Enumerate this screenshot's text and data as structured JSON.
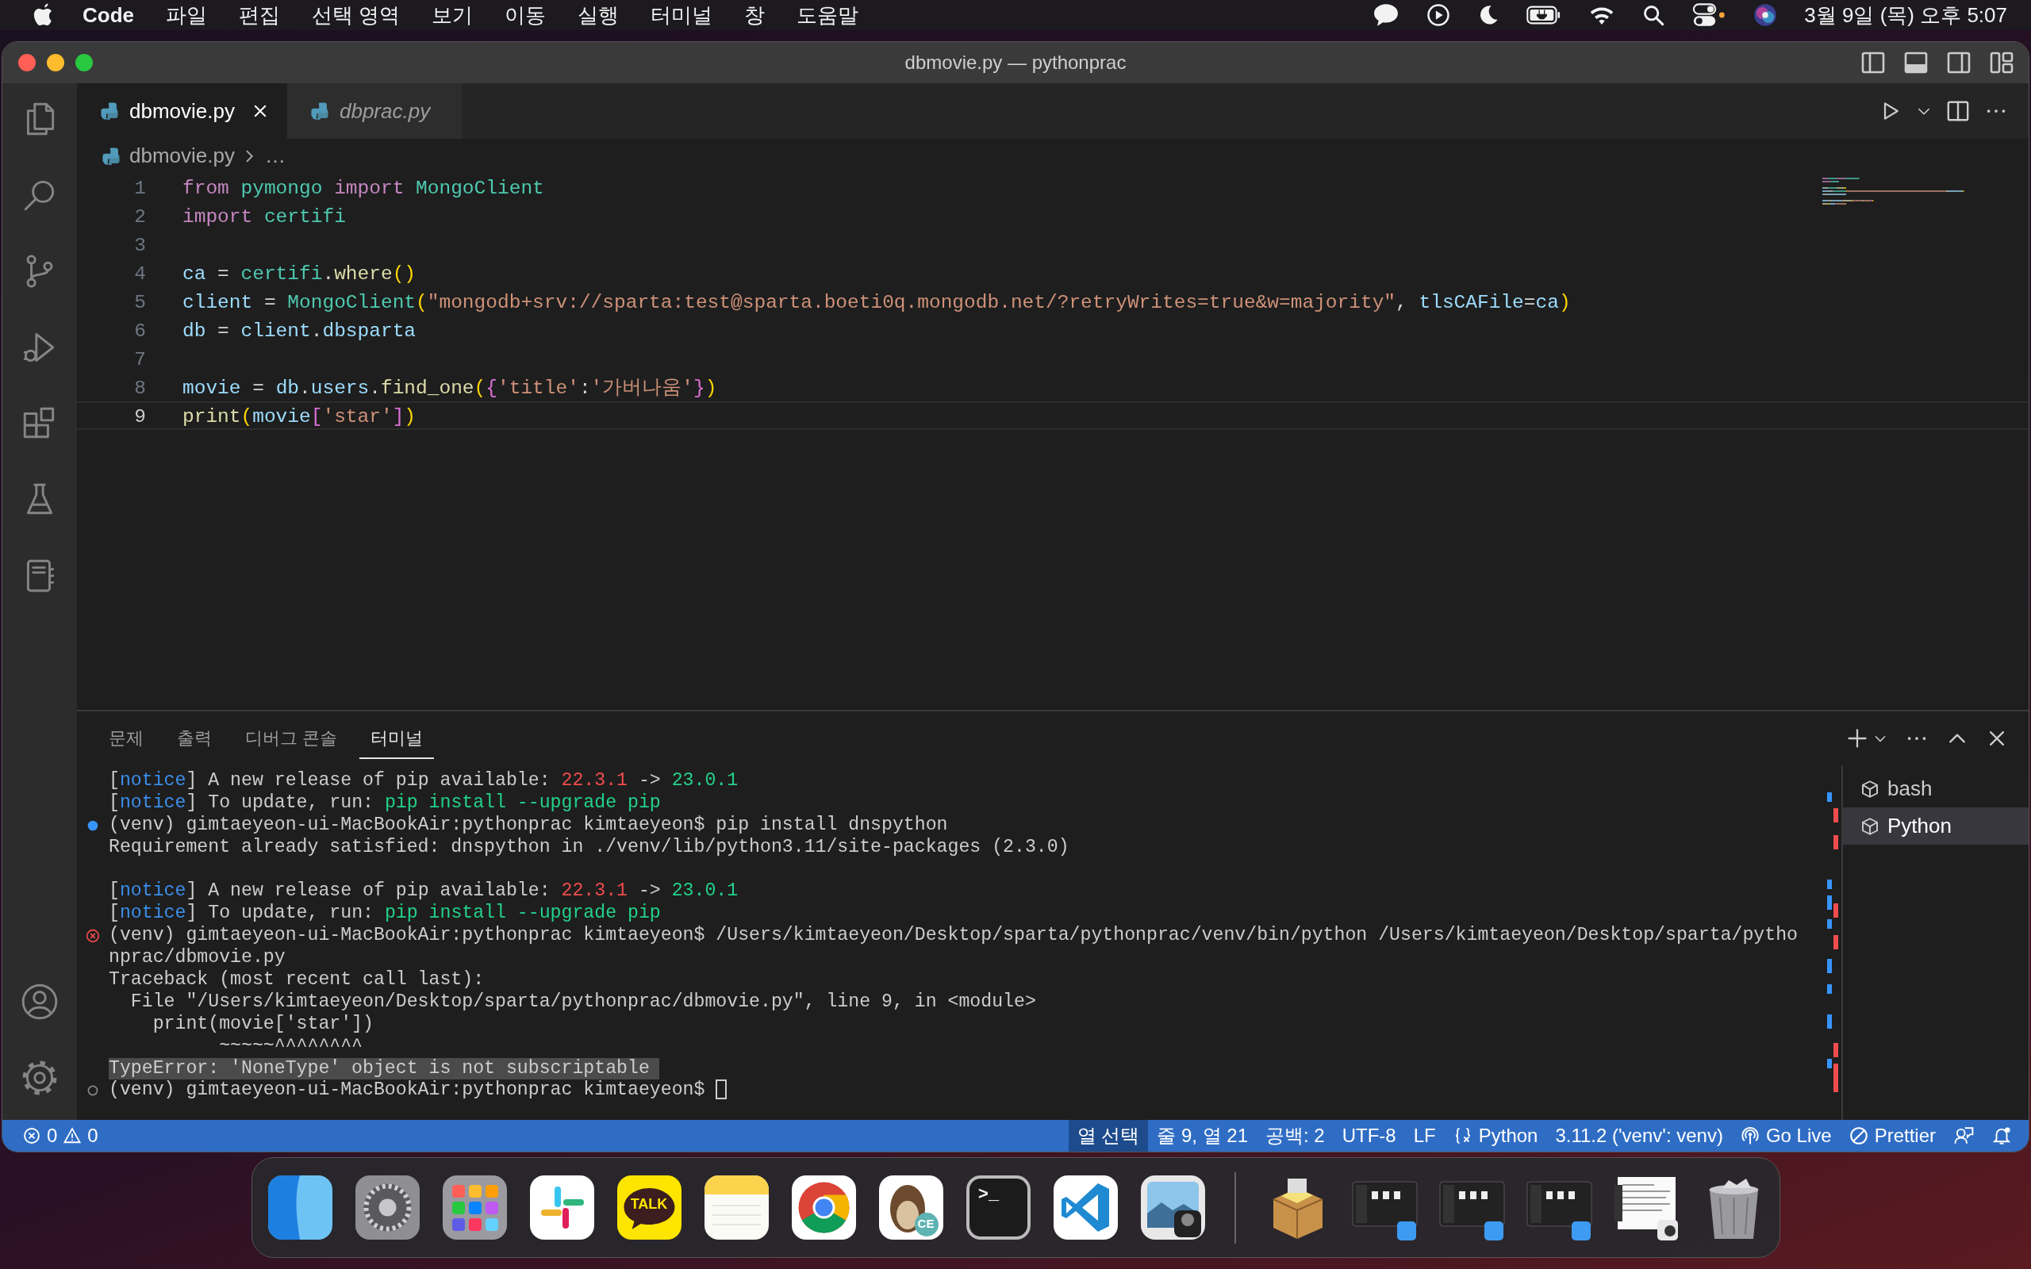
{
  "menu_bar": {
    "app": "Code",
    "menus": [
      "파일",
      "편집",
      "선택 영역",
      "보기",
      "이동",
      "실행",
      "터미널",
      "창",
      "도움말"
    ],
    "clock": "3월 9일 (목) 오후 5:07"
  },
  "window": {
    "title": "dbmovie.py — pythonprac"
  },
  "tabs": [
    {
      "label": "dbmovie.py",
      "selected": true,
      "preview": false
    },
    {
      "label": "dbprac.py",
      "selected": false,
      "preview": true
    }
  ],
  "breadcrumb": [
    "dbmovie.py",
    "…"
  ],
  "code_lines": [
    {
      "number": "1",
      "current": false,
      "tokens": [
        {
          "text": "from ",
          "kind": "keyword"
        },
        {
          "text": "pymongo",
          "kind": "module"
        },
        {
          "text": " import ",
          "kind": "keyword"
        },
        {
          "text": "MongoClient",
          "kind": "module"
        }
      ]
    },
    {
      "number": "2",
      "current": false,
      "tokens": [
        {
          "text": "import ",
          "kind": "keyword"
        },
        {
          "text": "certifi",
          "kind": "module"
        }
      ]
    },
    {
      "number": "3",
      "current": false
    },
    {
      "number": "4",
      "current": false,
      "tokens": [
        {
          "text": "ca",
          "kind": "variable"
        },
        {
          "text": " = ",
          "kind": "plain"
        },
        {
          "text": "certifi",
          "kind": "module"
        },
        {
          "text": ".",
          "kind": "plain"
        },
        {
          "text": "where",
          "kind": "function"
        },
        {
          "text": "()",
          "kind": "bracket1"
        }
      ]
    },
    {
      "number": "5",
      "current": false,
      "tokens": [
        {
          "text": "client",
          "kind": "variable"
        },
        {
          "text": " = ",
          "kind": "plain"
        },
        {
          "text": "MongoClient",
          "kind": "module"
        },
        {
          "text": "(",
          "kind": "bracket1"
        },
        {
          "text": "\"mongodb+srv://sparta:test@sparta.boeti0q.mongodb.net/?retryWrites=true&w=majority\"",
          "kind": "string"
        },
        {
          "text": ", ",
          "kind": "plain"
        },
        {
          "text": "tlsCAFile",
          "kind": "variable"
        },
        {
          "text": "=",
          "kind": "plain"
        },
        {
          "text": "ca",
          "kind": "variable"
        },
        {
          "text": ")",
          "kind": "bracket1"
        }
      ]
    },
    {
      "number": "6",
      "current": false,
      "tokens": [
        {
          "text": "db",
          "kind": "variable"
        },
        {
          "text": " = ",
          "kind": "plain"
        },
        {
          "text": "client",
          "kind": "variable"
        },
        {
          "text": ".",
          "kind": "plain"
        },
        {
          "text": "dbsparta",
          "kind": "variable"
        }
      ]
    },
    {
      "number": "7",
      "current": false
    },
    {
      "number": "8",
      "current": false,
      "tokens": [
        {
          "text": "movie",
          "kind": "variable"
        },
        {
          "text": " = ",
          "kind": "plain"
        },
        {
          "text": "db",
          "kind": "variable"
        },
        {
          "text": ".",
          "kind": "plain"
        },
        {
          "text": "users",
          "kind": "variable"
        },
        {
          "text": ".",
          "kind": "plain"
        },
        {
          "text": "find_one",
          "kind": "function"
        },
        {
          "text": "(",
          "kind": "bracket1"
        },
        {
          "text": "{",
          "kind": "bracket2"
        },
        {
          "text": "'title'",
          "kind": "string"
        },
        {
          "text": ":",
          "kind": "plain"
        },
        {
          "text": "'가버나움'",
          "kind": "string"
        },
        {
          "text": "}",
          "kind": "bracket2"
        },
        {
          "text": ")",
          "kind": "bracket1"
        }
      ]
    },
    {
      "number": "9",
      "current": true,
      "tokens": [
        {
          "text": "print",
          "kind": "function"
        },
        {
          "text": "(",
          "kind": "bracket1"
        },
        {
          "text": "movie",
          "kind": "variable"
        },
        {
          "text": "[",
          "kind": "bracket2"
        },
        {
          "text": "'star'",
          "kind": "string"
        },
        {
          "text": "]",
          "kind": "bracket2"
        },
        {
          "text": ")",
          "kind": "bracket1"
        }
      ]
    }
  ],
  "panel": {
    "tabs": [
      {
        "label": "문제",
        "selected": false
      },
      {
        "label": "출력",
        "selected": false
      },
      {
        "label": "디버그 콘솔",
        "selected": false
      },
      {
        "label": "터미널",
        "selected": true
      }
    ],
    "terminal_lines": [
      {
        "kind": "output",
        "tokens": [
          {
            "text": "[",
            "kind": "plain"
          },
          {
            "text": "notice",
            "kind": "label"
          },
          {
            "text": "] A new release of pip available: ",
            "kind": "plain"
          },
          {
            "text": "22.3.1",
            "kind": "old-version"
          },
          {
            "text": " -> ",
            "kind": "plain"
          },
          {
            "text": "23.0.1",
            "kind": "new-version"
          }
        ]
      },
      {
        "kind": "output",
        "tokens": [
          {
            "text": "[",
            "kind": "plain"
          },
          {
            "text": "notice",
            "kind": "label"
          },
          {
            "text": "] To update, run: ",
            "kind": "plain"
          },
          {
            "text": "pip install --upgrade pip",
            "kind": "command"
          }
        ]
      },
      {
        "kind": "success",
        "tokens": [
          {
            "text": "(venv) gimtaeyeon-ui-MacBookAir:pythonprac kimtaeyeon$ pip install dnspython",
            "kind": "plain"
          }
        ]
      },
      {
        "kind": "output",
        "tokens": [
          {
            "text": "Requirement already satisfied: dnspython in ./venv/lib/python3.11/site-packages (2.3.0)",
            "kind": "plain"
          }
        ]
      },
      {
        "kind": "blank"
      },
      {
        "kind": "output",
        "tokens": [
          {
            "text": "[",
            "kind": "plain"
          },
          {
            "text": "notice",
            "kind": "label"
          },
          {
            "text": "] A new release of pip available: ",
            "kind": "plain"
          },
          {
            "text": "22.3.1",
            "kind": "old-version"
          },
          {
            "text": " -> ",
            "kind": "plain"
          },
          {
            "text": "23.0.1",
            "kind": "new-version"
          }
        ]
      },
      {
        "kind": "output",
        "tokens": [
          {
            "text": "[",
            "kind": "plain"
          },
          {
            "text": "notice",
            "kind": "label"
          },
          {
            "text": "] To update, run: ",
            "kind": "plain"
          },
          {
            "text": "pip install --upgrade pip",
            "kind": "command"
          }
        ]
      },
      {
        "kind": "error",
        "tokens": [
          {
            "text": "(venv) gimtaeyeon-ui-MacBookAir:pythonprac kimtaeyeon$ /Users/kimtaeyeon/Desktop/sparta/pythonprac/venv/bin/python /Users/kimtaeyeon/Desktop/sparta/pytho",
            "kind": "plain"
          }
        ]
      },
      {
        "kind": "output",
        "tokens": [
          {
            "text": "nprac/dbmovie.py",
            "kind": "plain"
          }
        ]
      },
      {
        "kind": "output",
        "tokens": [
          {
            "text": "Traceback (most recent call last):",
            "kind": "plain"
          }
        ]
      },
      {
        "kind": "output",
        "tokens": [
          {
            "text": "  File \"/Users/kimtaeyeon/Desktop/sparta/pythonprac/dbmovie.py\", line 9, in <module>",
            "kind": "plain"
          }
        ]
      },
      {
        "kind": "output",
        "tokens": [
          {
            "text": "    print(movie['star'])",
            "kind": "plain"
          }
        ]
      },
      {
        "kind": "output",
        "tokens": [
          {
            "text": "          ~~~~~^^^^^^^^",
            "kind": "plain"
          }
        ]
      },
      {
        "kind": "selected",
        "tokens": [
          {
            "text": "TypeError: 'NoneType' object is not subscriptable",
            "kind": "plain"
          }
        ]
      },
      {
        "kind": "idle",
        "cursor": true,
        "tokens": [
          {
            "text": "(venv) gimtaeyeon-ui-MacBookAir:pythonprac kimtaeyeon$ ",
            "kind": "plain"
          }
        ]
      }
    ],
    "terminals": [
      {
        "label": "bash",
        "selected": false
      },
      {
        "label": "Python",
        "selected": true
      }
    ]
  },
  "status_bar": {
    "errors": "0",
    "warnings": "0",
    "items": [
      {
        "label": "열 선택",
        "kind": "text",
        "highlighted": true
      },
      {
        "label": "줄 9, 열 21",
        "kind": "text",
        "highlighted": false
      },
      {
        "label": "공백: 2",
        "kind": "text",
        "highlighted": false
      },
      {
        "label": "UTF-8",
        "kind": "text",
        "highlighted": false
      },
      {
        "label": "LF",
        "kind": "text",
        "highlighted": false
      },
      {
        "label": "Python",
        "kind": "language",
        "highlighted": false
      },
      {
        "label": "3.11.2 ('venv': venv)",
        "kind": "text",
        "highlighted": false
      },
      {
        "label": "Go Live",
        "kind": "live",
        "highlighted": false
      },
      {
        "label": "Prettier",
        "kind": "prettier",
        "highlighted": false
      }
    ]
  },
  "dock": [
    {
      "kind": "finder"
    },
    {
      "kind": "settings"
    },
    {
      "kind": "launchpad"
    },
    {
      "kind": "slack"
    },
    {
      "kind": "talk",
      "label": "TALK"
    },
    {
      "kind": "notes"
    },
    {
      "kind": "chrome"
    },
    {
      "kind": "beaver",
      "label": "CE"
    },
    {
      "kind": "terminal",
      "label": ">_"
    },
    {
      "kind": "vscode"
    },
    {
      "kind": "preview"
    },
    {
      "kind": "separator"
    },
    {
      "kind": "package"
    },
    {
      "kind": "thumbnail"
    },
    {
      "kind": "thumbnail"
    },
    {
      "kind": "thumbnail"
    },
    {
      "kind": "document"
    },
    {
      "kind": "trash"
    }
  ]
}
